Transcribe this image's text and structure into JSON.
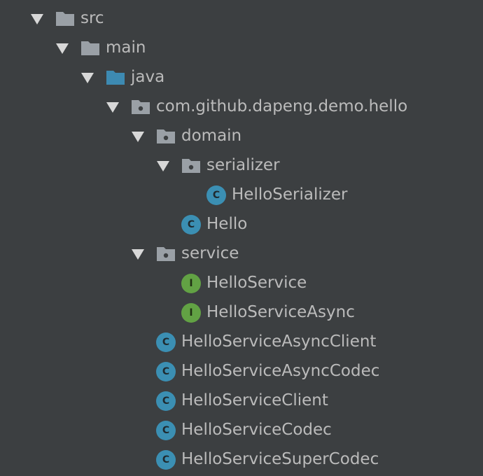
{
  "colors": {
    "background": "#3c3f41",
    "text": "#bbbbbb",
    "folder_gray": "#9aa0a6",
    "folder_source": "#3d8ab2",
    "class_badge": "#3b8fb3",
    "interface_badge": "#62a244"
  },
  "tree": {
    "src": "src",
    "main": "main",
    "java": "java",
    "package_root": "com.github.dapeng.demo.hello",
    "domain": "domain",
    "serializer": "serializer",
    "hello_serializer": "HelloSerializer",
    "hello": "Hello",
    "service": "service",
    "hello_service": "HelloService",
    "hello_service_async": "HelloServiceAsync",
    "hello_service_async_client": "HelloServiceAsyncClient",
    "hello_service_async_codec": "HelloServiceAsyncCodec",
    "hello_service_client": "HelloServiceClient",
    "hello_service_codec": "HelloServiceCodec",
    "hello_service_super_codec": "HelloServiceSuperCodec"
  },
  "badges": {
    "class": "C",
    "interface": "I"
  },
  "icons": {
    "expand": "triangle-down-icon",
    "folder": "folder-icon",
    "source_folder": "source-folder-icon",
    "package": "package-icon",
    "class": "class-icon",
    "interface": "interface-icon"
  }
}
